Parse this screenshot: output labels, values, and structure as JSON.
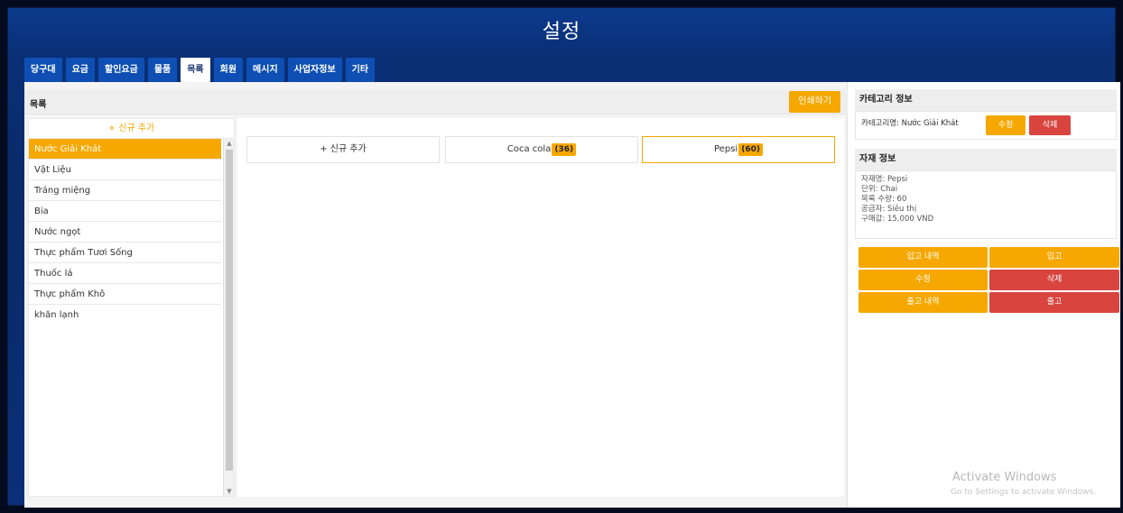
{
  "window": {
    "title": "설정"
  },
  "tabs": [
    "당구대",
    "요금",
    "할인요금",
    "물품",
    "목록",
    "회원",
    "메시지",
    "사업자정보",
    "기타"
  ],
  "active_tab": "목록",
  "main": {
    "title": "목록",
    "print_label": "인쇄하기",
    "add_label": "+ 신규 추가"
  },
  "categories": [
    "Nước Giải Khát",
    "Vật Liệu",
    "Tráng miệng",
    "Bia",
    "Nước ngọt",
    "Thực phẩm Tươi Sống",
    "Thuốc lá",
    "Thực phẩm Khô",
    "khăn lạnh"
  ],
  "active_category": "Nước Giải Khát",
  "products": {
    "add_label": "+ 신규 추가",
    "items": [
      {
        "name": "Coca cola",
        "count": "(36)"
      },
      {
        "name": "Pepsi",
        "count": "(60)"
      }
    ]
  },
  "category_info": {
    "header": "카테고리 정보",
    "label": "카테고리명: Nước Giải Khát",
    "edit": "수정",
    "delete": "삭제"
  },
  "item_info": {
    "header": "자재 정보",
    "lines": [
      "자재명: Pepsi",
      "단위: Chai",
      "목록 수량: 60",
      "공급자: Siêu thị",
      "구매값: 15,000 VND"
    ]
  },
  "actions": {
    "inbound_history": "입고 내역",
    "inbound": "입고",
    "edit": "수정",
    "delete": "삭제",
    "outbound_history": "출고 내역",
    "outbound": "출고"
  },
  "watermark": {
    "line1": "Activate Windows",
    "line2": "Go to Settings to activate Windows."
  },
  "colors": {
    "accent": "#f6a800",
    "danger": "#d9443f",
    "tab": "#0f4fb3"
  }
}
